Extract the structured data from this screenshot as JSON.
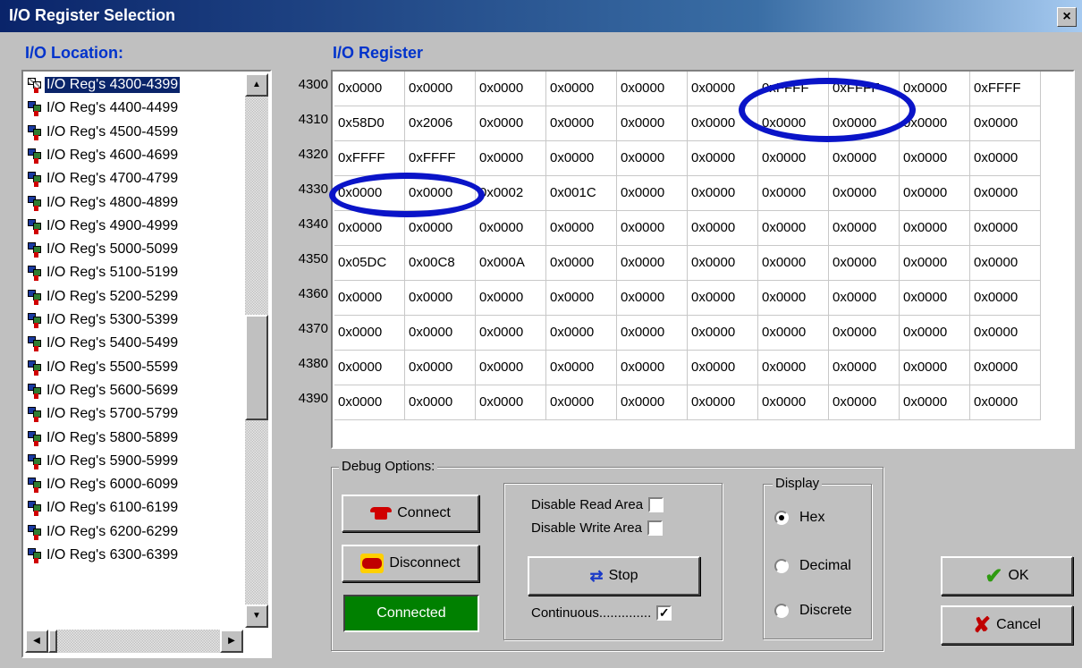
{
  "window": {
    "title": "I/O Register Selection",
    "close_glyph": "×"
  },
  "location": {
    "label": "I/O Location:",
    "items": [
      "I/O Reg's 4300-4399",
      "I/O Reg's 4400-4499",
      "I/O Reg's 4500-4599",
      "I/O Reg's 4600-4699",
      "I/O Reg's 4700-4799",
      "I/O Reg's 4800-4899",
      "I/O Reg's 4900-4999",
      "I/O Reg's 5000-5099",
      "I/O Reg's 5100-5199",
      "I/O Reg's 5200-5299",
      "I/O Reg's 5300-5399",
      "I/O Reg's 5400-5499",
      "I/O Reg's 5500-5599",
      "I/O Reg's 5600-5699",
      "I/O Reg's 5700-5799",
      "I/O Reg's 5800-5899",
      "I/O Reg's 5900-5999",
      "I/O Reg's 6000-6099",
      "I/O Reg's 6100-6199",
      "I/O Reg's 6200-6299",
      "I/O Reg's 6300-6399"
    ],
    "selected_index": 0,
    "item_icon": "network-register-icon"
  },
  "register": {
    "label": "I/O Register",
    "row_labels": [
      "4300",
      "4310",
      "4320",
      "4330",
      "4340",
      "4350",
      "4360",
      "4370",
      "4380",
      "4390"
    ],
    "rows": [
      [
        "0x0000",
        "0x0000",
        "0x0000",
        "0x0000",
        "0x0000",
        "0x0000",
        "0xFFFF",
        "0xFFFF",
        "0x0000",
        "0xFFFF"
      ],
      [
        "0x58D0",
        "0x2006",
        "0x0000",
        "0x0000",
        "0x0000",
        "0x0000",
        "0x0000",
        "0x0000",
        "0x0000",
        "0x0000"
      ],
      [
        "0xFFFF",
        "0xFFFF",
        "0x0000",
        "0x0000",
        "0x0000",
        "0x0000",
        "0x0000",
        "0x0000",
        "0x0000",
        "0x0000"
      ],
      [
        "0x0000",
        "0x0000",
        "0x0002",
        "0x001C",
        "0x0000",
        "0x0000",
        "0x0000",
        "0x0000",
        "0x0000",
        "0x0000"
      ],
      [
        "0x0000",
        "0x0000",
        "0x0000",
        "0x0000",
        "0x0000",
        "0x0000",
        "0x0000",
        "0x0000",
        "0x0000",
        "0x0000"
      ],
      [
        "0x05DC",
        "0x00C8",
        "0x000A",
        "0x0000",
        "0x0000",
        "0x0000",
        "0x0000",
        "0x0000",
        "0x0000",
        "0x0000"
      ],
      [
        "0x0000",
        "0x0000",
        "0x0000",
        "0x0000",
        "0x0000",
        "0x0000",
        "0x0000",
        "0x0000",
        "0x0000",
        "0x0000"
      ],
      [
        "0x0000",
        "0x0000",
        "0x0000",
        "0x0000",
        "0x0000",
        "0x0000",
        "0x0000",
        "0x0000",
        "0x0000",
        "0x0000"
      ],
      [
        "0x0000",
        "0x0000",
        "0x0000",
        "0x0000",
        "0x0000",
        "0x0000",
        "0x0000",
        "0x0000",
        "0x0000",
        "0x0000"
      ],
      [
        "0x0000",
        "0x0000",
        "0x0000",
        "0x0000",
        "0x0000",
        "0x0000",
        "0x0000",
        "0x0000",
        "0x0000",
        "0x0000"
      ]
    ],
    "highlight_color": "#0a14c8"
  },
  "debug": {
    "group_label": "Debug Options:",
    "connect_label": "Connect",
    "disconnect_label": "Disconnect",
    "status_label": "Connected",
    "status_color": "#008000",
    "disable_read_label": "Disable Read Area",
    "disable_read_checked": false,
    "disable_write_label": "Disable Write Area",
    "disable_write_checked": false,
    "stop_label": "Stop",
    "continuous_label": "Continuous..............",
    "continuous_checked": true
  },
  "display": {
    "group_label": "Display",
    "options": [
      "Hex",
      "Decimal",
      "Discrete"
    ],
    "selected": "Hex"
  },
  "dialog": {
    "ok_label": "OK",
    "cancel_label": "Cancel"
  }
}
